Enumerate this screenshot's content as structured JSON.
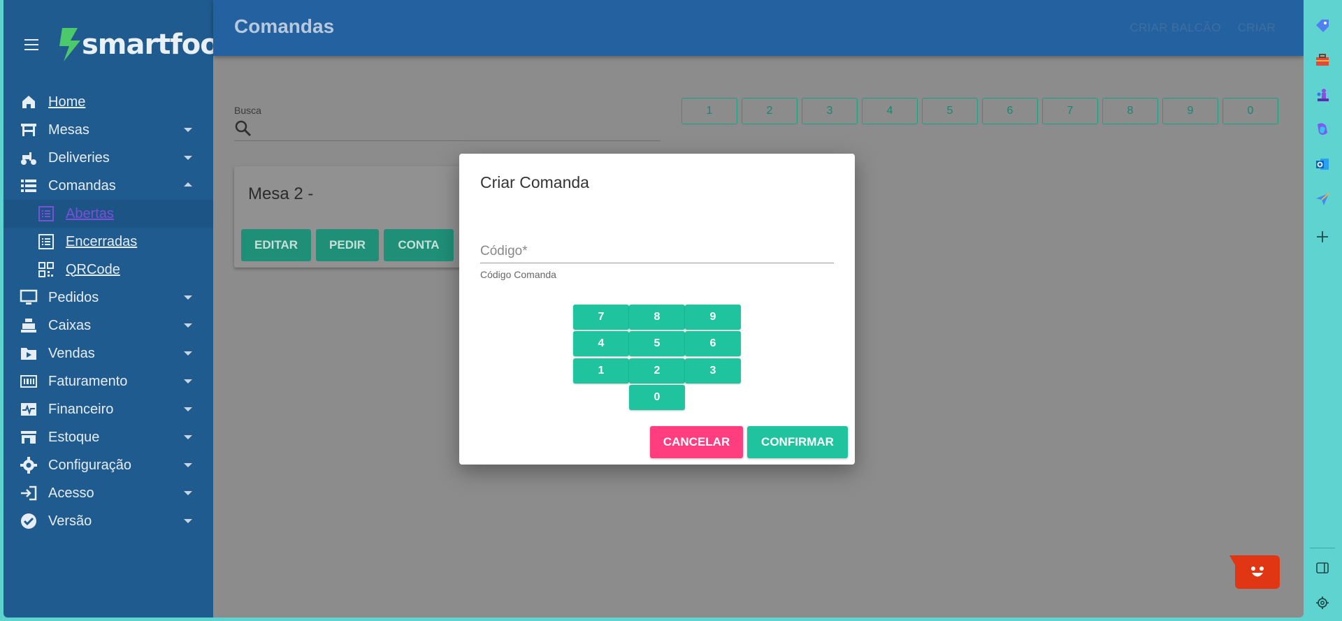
{
  "brand": {
    "name": "smartfood"
  },
  "sidebar": {
    "items": [
      {
        "label": "Home",
        "icon": "home-icon",
        "underline": true
      },
      {
        "label": "Mesas",
        "icon": "table-icon",
        "caret": "down"
      },
      {
        "label": "Deliveries",
        "icon": "scooter-icon",
        "caret": "down"
      },
      {
        "label": "Comandas",
        "icon": "list-icon",
        "caret": "up"
      },
      {
        "label": "Abertas",
        "icon": "list-box-icon",
        "sub": true,
        "active": true
      },
      {
        "label": "Encerradas",
        "icon": "list-box-icon",
        "sub": true
      },
      {
        "label": "QRCode",
        "icon": "qrcode-icon",
        "sub": true
      },
      {
        "label": "Pedidos",
        "icon": "monitor-icon",
        "caret": "down"
      },
      {
        "label": "Caixas",
        "icon": "cash-register-icon",
        "caret": "down"
      },
      {
        "label": "Vendas",
        "icon": "play-folder-icon",
        "caret": "down"
      },
      {
        "label": "Faturamento",
        "icon": "barcode-icon",
        "caret": "down"
      },
      {
        "label": "Financeiro",
        "icon": "pulse-icon",
        "caret": "down"
      },
      {
        "label": "Estoque",
        "icon": "store-icon",
        "caret": "down"
      },
      {
        "label": "Configuração",
        "icon": "gear-icon",
        "caret": "down"
      },
      {
        "label": "Acesso",
        "icon": "login-icon",
        "caret": "down"
      },
      {
        "label": "Versão",
        "icon": "verified-icon",
        "caret": "down"
      }
    ]
  },
  "topbar": {
    "title": "Comandas",
    "actions": [
      "CRIAR BALCÃO",
      "CRIAR"
    ]
  },
  "main": {
    "search": {
      "label": "Busca"
    },
    "number_filters": [
      "1",
      "2",
      "3",
      "4",
      "5",
      "6",
      "7",
      "8",
      "9",
      "0"
    ],
    "card": {
      "title": "Mesa 2 -",
      "buttons": [
        "EDITAR",
        "PEDIR",
        "CONTA"
      ]
    }
  },
  "modal": {
    "title": "Criar Comanda",
    "field_placeholder": "Código*",
    "field_value": "",
    "helper": "Código Comanda",
    "keypad": [
      "7",
      "8",
      "9",
      "4",
      "5",
      "6",
      "1",
      "2",
      "3",
      "0"
    ],
    "cancel_label": "CANCELAR",
    "confirm_label": "CONFIRMAR"
  },
  "colors": {
    "sidebar": "#1f5b8f",
    "topbar": "#2361a0",
    "accent_green": "#1fc49e",
    "cancel_pink": "#ff3d7f",
    "chat_red": "#e03614",
    "rail": "#5fd3cf"
  },
  "rail_icons": [
    "tag-icon",
    "toolbox-icon",
    "chess-icon",
    "copilot-icon",
    "outlook-icon",
    "send-icon",
    "plus-icon",
    "sidebar-toggle-icon",
    "settings-icon"
  ]
}
